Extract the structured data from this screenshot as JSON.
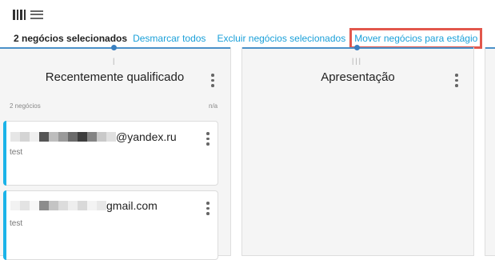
{
  "toolbar": {
    "board_view_icon": "board-view-icon",
    "list_view_icon": "list-view-icon"
  },
  "selection_bar": {
    "count_label": "2 negócios selecionados",
    "unselect_all": "Desmarcar todos",
    "delete_selected": "Excluir negócios selecionados",
    "move_to_stage": "Mover negócios para estágio"
  },
  "columns": [
    {
      "title": "Recentemente qualificado",
      "deal_count": "2 negócios",
      "amount": "n/a",
      "cards": [
        {
          "title_suffix": "@yandex.ru",
          "description": "test"
        },
        {
          "title_suffix": "gmail.com",
          "description": "test"
        }
      ]
    },
    {
      "title": "Apresentação",
      "cards": []
    }
  ],
  "colors": {
    "accent": "#1aa0d9",
    "card_stripe": "#1bb3e8",
    "highlight_box": "#e2574c",
    "column_top": "#4a90c8"
  }
}
